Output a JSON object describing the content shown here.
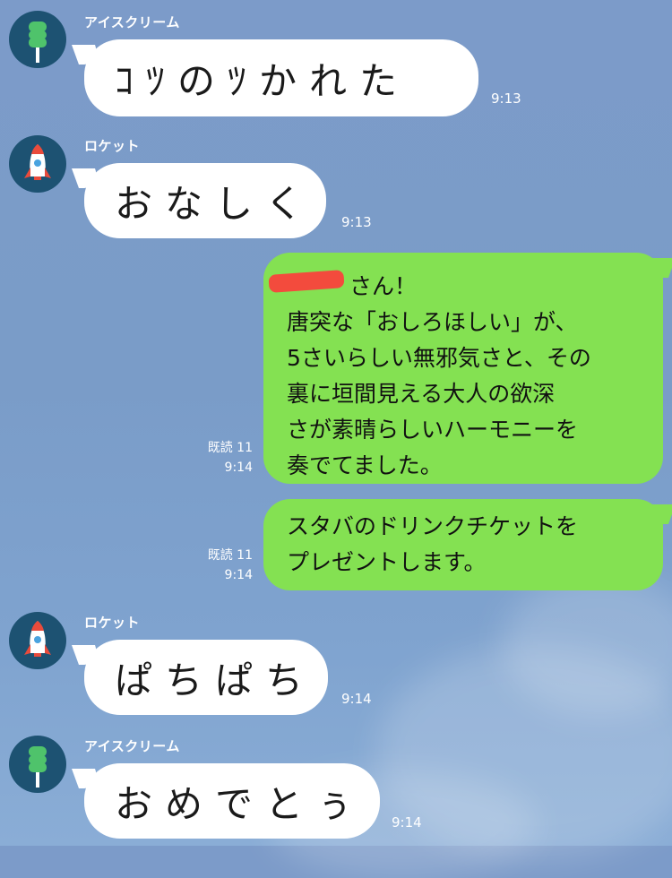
{
  "messages": [
    {
      "sender": "アイスクリーム",
      "avatar": "ice-cream-bar-icon",
      "text": "ｺﾂのﾂかれた",
      "time": "9:13"
    },
    {
      "sender": "ロケット",
      "avatar": "rocket-icon",
      "text": "おなしく",
      "time": "9:13"
    },
    {
      "sender": "me",
      "lines": [
        "さん！",
        "唐突な「おしろほしい」が、",
        "5さいらしい無邪気さと、その",
        "裏に垣間見える大人の欲深",
        "さが素晴らしいハーモニーを",
        "奏でてました。"
      ],
      "read": "既読 11",
      "time": "9:14"
    },
    {
      "sender": "me",
      "lines": [
        "スタバのドリンクチケットを",
        "プレゼントします。"
      ],
      "read": "既読 11",
      "time": "9:14"
    },
    {
      "sender": "ロケット",
      "avatar": "rocket-icon",
      "text": "ぱちぱち",
      "time": "9:14"
    },
    {
      "sender": "アイスクリーム",
      "avatar": "ice-cream-bar-icon",
      "text": "おめでとぅ",
      "time": "9:14"
    }
  ],
  "colors": {
    "background": "#7c9bc9",
    "outgoing_bubble": "#84e152",
    "incoming_bubble": "#ffffff",
    "avatar_bg": "#1d5272",
    "redaction": "#ff3b3b"
  }
}
